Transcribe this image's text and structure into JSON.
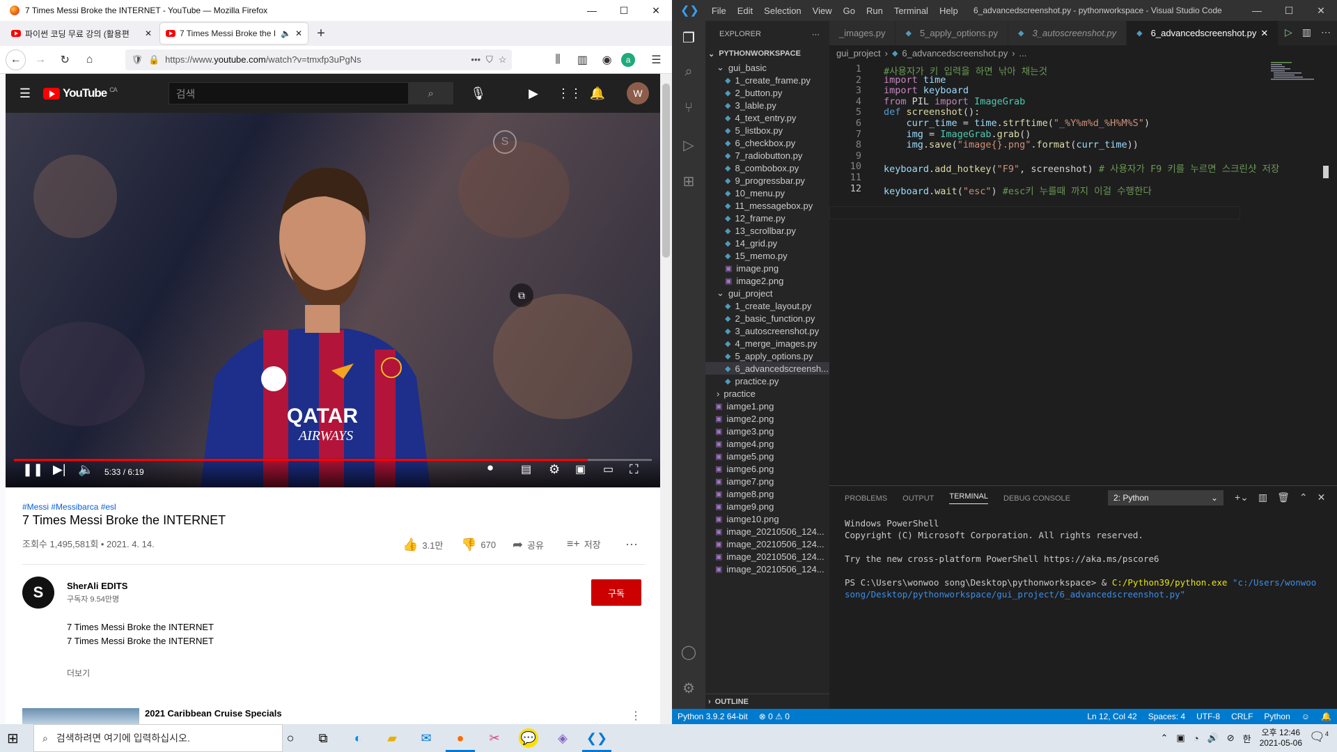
{
  "firefox": {
    "window_title": "7 Times Messi Broke the INTERNET - YouTube — Mozilla Firefox",
    "tabs": [
      {
        "label": "파이썬 코딩 무료 강의 (활용편"
      },
      {
        "label": "7 Times Messi Broke the I"
      }
    ],
    "url_prefix": "https://www.",
    "url_domain": "youtube.com",
    "url_suffix": "/watch?v=tmxfp3uPgNs"
  },
  "youtube": {
    "logo_text": "YouTube",
    "logo_region": "CA",
    "search_placeholder": "검색",
    "avatar_letter": "W",
    "video": {
      "current_time": "5:33",
      "duration": "6:19",
      "progress": 0.9,
      "time_display": "5:33 / 6:19",
      "jersey_text": "QATAR",
      "jersey_text2": "AIRWAYS"
    },
    "tags": "#Messi #Messibarca #esl",
    "title": "7 Times Messi Broke the INTERNET",
    "views": "조회수 1,495,581회 • 2021. 4. 14.",
    "likes": "3.1만",
    "dislikes": "670",
    "share": "공유",
    "save": "저장",
    "channel": {
      "name": "SherAli EDITS",
      "subscribers": "구독자 9.54만명",
      "avatar_letter": "S"
    },
    "subscribe_label": "구독",
    "description": [
      "7 Times Messi Broke the INTERNET",
      "7 Times Messi Broke the INTERNET"
    ],
    "more_label": "더보기",
    "recommended_title": "2021 Caribbean Cruise Specials"
  },
  "vscode": {
    "menu": [
      "File",
      "Edit",
      "Selection",
      "View",
      "Go",
      "Run",
      "Terminal",
      "Help"
    ],
    "window_title": "6_advancedscreenshot.py - pythonworkspace - Visual Studio Code",
    "explorer_header": "EXPLORER",
    "workspace": "PYTHONWORKSPACE",
    "tree": [
      {
        "type": "folder",
        "label": "gui_basic",
        "open": true
      },
      {
        "type": "py",
        "label": "1_create_frame.py"
      },
      {
        "type": "py",
        "label": "2_button.py"
      },
      {
        "type": "py",
        "label": "3_lable.py"
      },
      {
        "type": "py",
        "label": "4_text_entry.py"
      },
      {
        "type": "py",
        "label": "5_listbox.py"
      },
      {
        "type": "py",
        "label": "6_checkbox.py"
      },
      {
        "type": "py",
        "label": "7_radiobutton.py"
      },
      {
        "type": "py",
        "label": "8_combobox.py"
      },
      {
        "type": "py",
        "label": "9_progressbar.py"
      },
      {
        "type": "py",
        "label": "10_menu.py"
      },
      {
        "type": "py",
        "label": "11_messagebox.py"
      },
      {
        "type": "py",
        "label": "12_frame.py"
      },
      {
        "type": "py",
        "label": "13_scrollbar.py"
      },
      {
        "type": "py",
        "label": "14_grid.py"
      },
      {
        "type": "py",
        "label": "15_memo.py"
      },
      {
        "type": "img",
        "label": "image.png"
      },
      {
        "type": "img",
        "label": "image2.png"
      },
      {
        "type": "folder",
        "label": "gui_project",
        "open": true
      },
      {
        "type": "py",
        "label": "1_create_layout.py"
      },
      {
        "type": "py",
        "label": "2_basic_function.py"
      },
      {
        "type": "py",
        "label": "3_autoscreenshot.py"
      },
      {
        "type": "py",
        "label": "4_merge_images.py"
      },
      {
        "type": "py",
        "label": "5_apply_options.py"
      },
      {
        "type": "py",
        "label": "6_advancedscreensh...",
        "selected": true
      },
      {
        "type": "py",
        "label": "practice.py"
      },
      {
        "type": "folder",
        "label": "practice",
        "open": false
      },
      {
        "type": "img",
        "label": "iamge1.png"
      },
      {
        "type": "img",
        "label": "iamge2.png"
      },
      {
        "type": "img",
        "label": "iamge3.png"
      },
      {
        "type": "img",
        "label": "iamge4.png"
      },
      {
        "type": "img",
        "label": "iamge5.png"
      },
      {
        "type": "img",
        "label": "iamge6.png"
      },
      {
        "type": "img",
        "label": "iamge7.png"
      },
      {
        "type": "img",
        "label": "iamge8.png"
      },
      {
        "type": "img",
        "label": "iamge9.png"
      },
      {
        "type": "img",
        "label": "iamge10.png"
      },
      {
        "type": "img",
        "label": "image_20210506_124..."
      },
      {
        "type": "img",
        "label": "image_20210506_124..."
      },
      {
        "type": "img",
        "label": "image_20210506_124..."
      },
      {
        "type": "img",
        "label": "image_20210506_124..."
      }
    ],
    "outline_label": "OUTLINE",
    "editor_tabs": [
      {
        "label": "_images.py"
      },
      {
        "label": "5_apply_options.py"
      },
      {
        "label": "3_autoscreenshot.py"
      },
      {
        "label": "6_advancedscreenshot.py",
        "active": true
      }
    ],
    "breadcrumb": [
      "gui_project",
      "6_advancedscreenshot.py",
      "..."
    ],
    "code_lines": [
      "#사용자가 키 입력을 하면 낚아 채는것",
      "import time",
      "import keyboard",
      "from PIL import ImageGrab",
      "def screenshot():",
      "    curr_time = time.strftime(\"_%Y%m%d_%H%M%S\")",
      "    img = ImageGrab.grab()",
      "    img.save(\"image{}.png\".format(curr_time))",
      "",
      "keyboard.add_hotkey(\"F9\", screenshot) # 사용자가 F9 키를 누르면 스크린샷 저장",
      "",
      "keyboard.wait(\"esc\") #esc키 누를때 까지 이걸 수행한다"
    ],
    "panel_tabs": [
      "PROBLEMS",
      "OUTPUT",
      "TERMINAL",
      "DEBUG CONSOLE"
    ],
    "terminal_select": "2: Python",
    "terminal_lines": [
      "Windows PowerShell",
      "Copyright (C) Microsoft Corporation. All rights reserved.",
      "",
      "Try the new cross-platform PowerShell https://aka.ms/pscore6",
      ""
    ],
    "prompt": "PS C:\\Users\\wonwoo song\\Desktop\\pythonworkspace> & ",
    "prompt_exe": "C:/Python39/python.exe",
    "prompt_arg": " \"c:/Users/wonwoo song/Desktop/pythonworkspace/gui_project/6_advancedscreenshot.py\"",
    "status": {
      "python": "Python 3.9.2 64-bit",
      "problems": "⊗ 0 ⚠ 0",
      "position": "Ln 12, Col 42",
      "spaces": "Spaces: 4",
      "encoding": "UTF-8",
      "eol": "CRLF",
      "language": "Python"
    }
  },
  "taskbar": {
    "search_placeholder": "검색하려면 여기에 입력하십시오.",
    "time": "오후 12:46",
    "date": "2021-05-06",
    "ime": "한",
    "notification_count": "4"
  }
}
